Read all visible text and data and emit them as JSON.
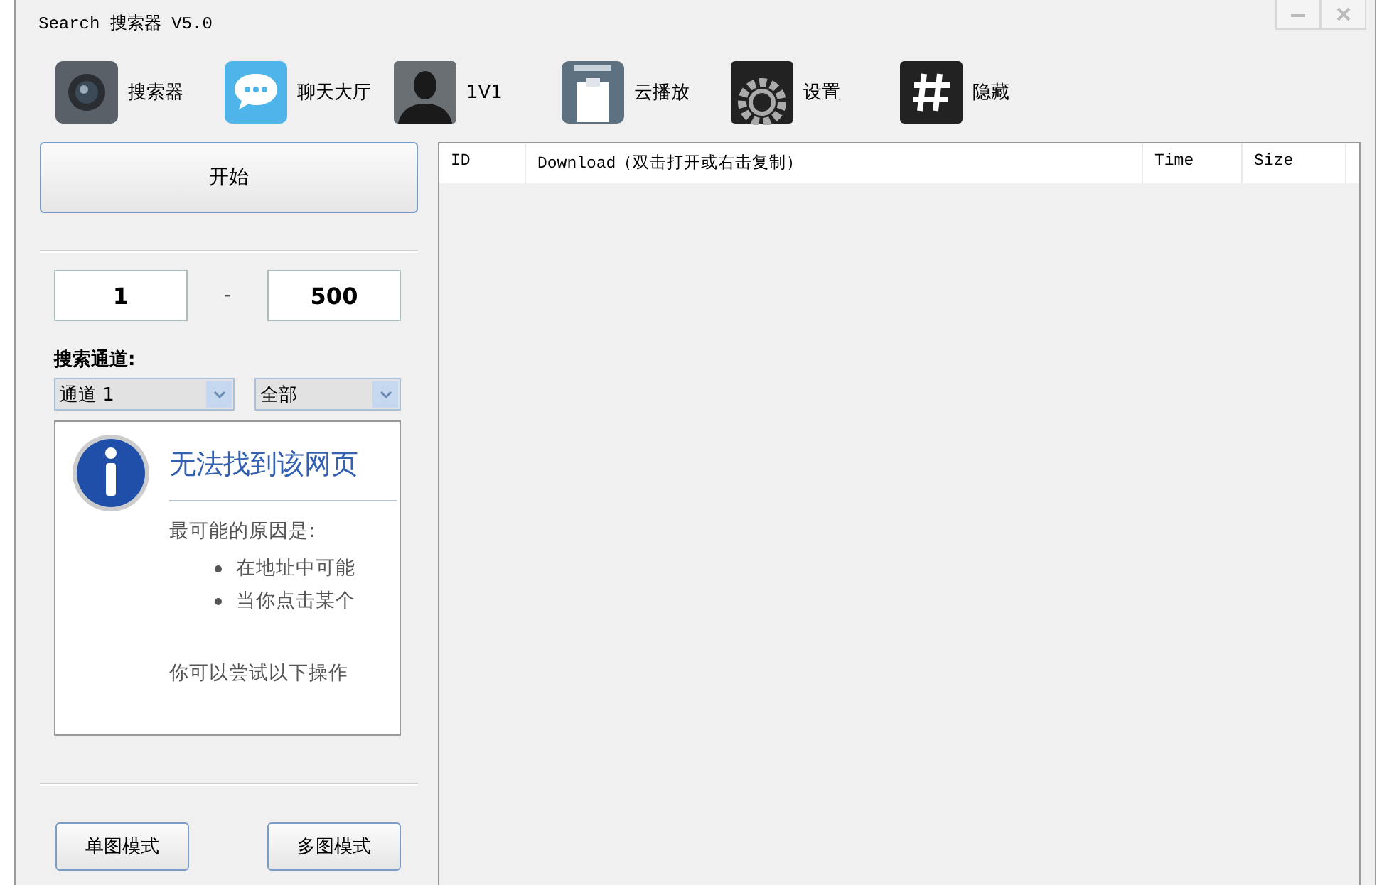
{
  "window": {
    "title": "Search 搜索器 V5.0"
  },
  "toolbar": [
    {
      "label": "搜索器"
    },
    {
      "label": "聊天大厅"
    },
    {
      "label": "1V1"
    },
    {
      "label": "云播放"
    },
    {
      "label": "设置"
    },
    {
      "label": "隐藏"
    }
  ],
  "start_button": "开始",
  "range": {
    "from": "1",
    "separator": "-",
    "to": "500"
  },
  "channel_label": "搜索通道:",
  "channel_select": "通道 1",
  "scope_select": "全部",
  "web_view": {
    "heading": "无法找到该网页",
    "reasons_title": "最可能的原因是:",
    "bullets": [
      "在地址中可能",
      "当你点击某个"
    ],
    "footer": "你可以尝试以下操作"
  },
  "mode_buttons": [
    "单图模式",
    "多图模式"
  ],
  "table": {
    "columns": [
      "ID",
      "Download（双击打开或右击复制）",
      "Time",
      "Size"
    ]
  }
}
